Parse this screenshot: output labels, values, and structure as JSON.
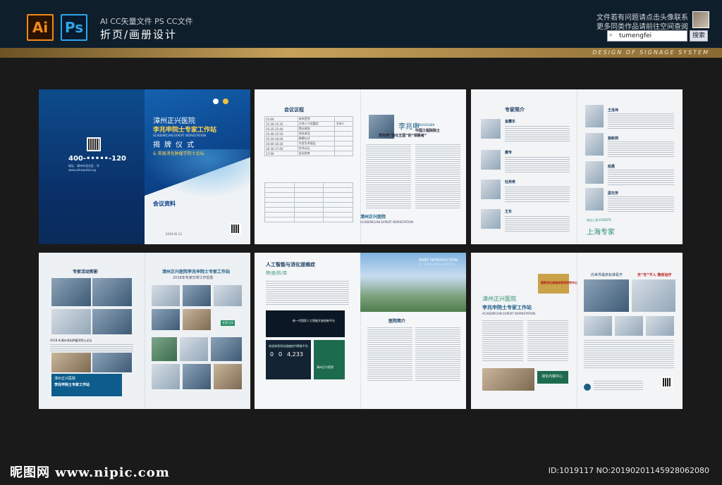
{
  "header": {
    "ai_logo": "Ai",
    "ps_logo": "Ps",
    "formats": "AI CC矢量文件   PS CC文件",
    "title": "折页/画册设计",
    "help_line1": "文件若有问题请点击头像联系",
    "help_line2": "更多同类作品请前往空间查阅",
    "search_value": "tumengfei",
    "search_button": "搜索",
    "band_text": "DESIGN OF SIGNAGE SYSTEM"
  },
  "cover": {
    "phone": "400-•••••-120",
    "address": "地址：漳州市龙文区...号",
    "website": "www.zxhospital.org",
    "hospital": "漳州正兴医院",
    "station": "李兆申院士专家工作站",
    "station_en": "ACADEMICIAN EXPERT WORKSTATION",
    "ceremony": "揭牌仪式",
    "forum": "& 首届消化肿瘤学院士论坛",
    "meeting_docs": "会议资料",
    "date": "2019.01.13"
  },
  "spread2": {
    "agenda_title": "会议议程",
    "agenda_rows": [
      [
        "15:00",
        "来宾签到",
        ""
      ],
      [
        "15:30-15:35",
        "主持人介绍嘉宾",
        "主持人"
      ],
      [
        "15:35-15:40",
        "院长致辞",
        ""
      ],
      [
        "15:40-15:50",
        "领导讲话",
        ""
      ],
      [
        "15:50-16:00",
        "揭牌仪式",
        ""
      ],
      [
        "16:00-16:30",
        "专家学术报告",
        ""
      ],
      [
        "16:30-17:00",
        "学术论坛",
        ""
      ],
      [
        "17:00",
        "会议结束",
        ""
      ]
    ],
    "name": "李兆申",
    "title_tag": "LI ZHAOSHEN",
    "academician": "中国工程院院士",
    "subtitle": "李兆申“消化王国”的“领路者”",
    "caption": "漳州正兴医院",
    "caption_en": "ACADEMICIAN EXPERT WORKSTATION"
  },
  "spread3": {
    "title": "专家简介",
    "doctors_left": [
      "金震东",
      "廉专",
      "杜奕奇",
      "王东"
    ],
    "doctors_right": [
      "王洛伟",
      "施新岗",
      "柏愚",
      "邵杰芳"
    ],
    "experts_en": "来自上海 EXPERTS",
    "experts_big": "上海专家"
  },
  "spread4": {
    "activities": "专家活动剪影",
    "station_title": "漳州正兴医院李兆申院士专家工作站",
    "station_sub": "2018年专家日常工作剪影",
    "caption": "2018 年漳州消化肿瘤学院士论坛",
    "box_line1": "漳州正兴医院",
    "box_line2": "李兆申院士专家工作站",
    "tag": "专家工作"
  },
  "spread5": {
    "title": "人工智能与消化道癌症",
    "subtitle": "筛/查/防/目",
    "card_text": "新一代国家人工智能开放创新平台",
    "counter1": "0",
    "counter2": "0",
    "stat": "4,233",
    "stat_label": "欢迎来到消化道癌症AI筛查平台",
    "green_label": "漳州正兴医院",
    "brief": "BRIEF INTRODUCTION",
    "brief2": "OF ZHENGXING HOSPITAL",
    "intro": "医院简介"
  },
  "spread6": {
    "hospital": "漳州正兴医院",
    "station": "李兆申院士专家工作站",
    "station_en": "ACADEMICIAN EXPERT WORKSTATION",
    "badge": "国家消化病临床医学研究中心",
    "dept": "消化内镜中心",
    "right_title": "向世界最高标准看齐",
    "right_red": "无“无”不入 微创治疗"
  },
  "footer": {
    "logo": "昵图网 www.nipic.com",
    "id": "ID:1019117 NO:20190201145928062080"
  }
}
